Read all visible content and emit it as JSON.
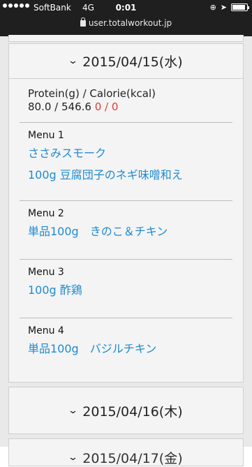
{
  "status_bar": {
    "carrier": "SoftBank",
    "network": "4G",
    "time": "0:01",
    "url": "user.totalworkout.jp",
    "signal_bars": 5,
    "battery_level": 0.9
  },
  "days": [
    {
      "date": "2015/04/15(水)",
      "summary_label": "Protein(g) / Calorie(kcal)",
      "summary_value": "80.0 / 546.6",
      "summary_actual": "0 / 0",
      "menus": [
        {
          "label": "Menu 1",
          "items": [
            "ささみスモーク",
            "100g 豆腐団子のネギ味噌和え"
          ]
        },
        {
          "label": "Menu 2",
          "items": [
            "単品100g　きのこ＆チキン"
          ]
        },
        {
          "label": "Menu 3",
          "items": [
            "100g 酢鶏"
          ]
        },
        {
          "label": "Menu 4",
          "items": [
            "単品100g　バジルチキン"
          ]
        }
      ]
    },
    {
      "date": "2015/04/16(木)"
    },
    {
      "date": "2015/04/17(金)"
    }
  ],
  "icons": {
    "expand": "chevron-down-icon",
    "lock": "lock-icon",
    "battery": "battery-icon",
    "location": "location-icon",
    "rotation_lock": "rotation-lock-icon"
  },
  "colors": {
    "link": "#1f8ad0",
    "accent_red": "#e03a3a",
    "status_bar_bg": "#1f1f1f"
  }
}
